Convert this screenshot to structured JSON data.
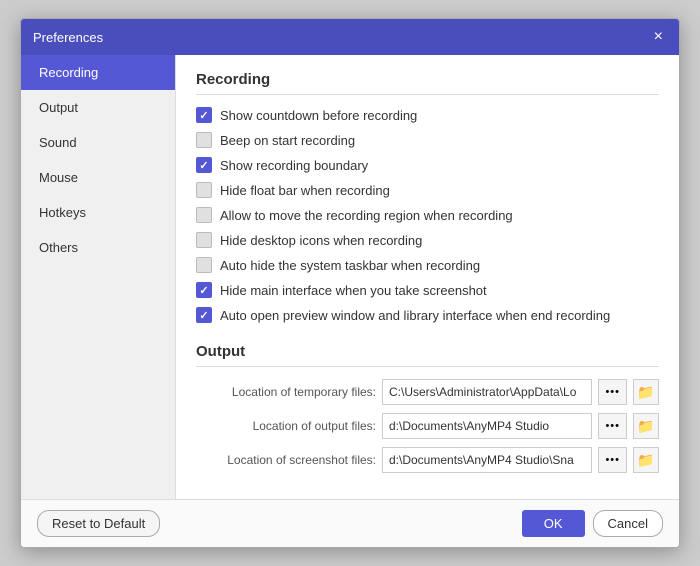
{
  "titleBar": {
    "title": "Preferences",
    "closeLabel": "×"
  },
  "sidebar": {
    "items": [
      {
        "id": "recording",
        "label": "Recording",
        "active": true
      },
      {
        "id": "output",
        "label": "Output",
        "active": false
      },
      {
        "id": "sound",
        "label": "Sound",
        "active": false
      },
      {
        "id": "mouse",
        "label": "Mouse",
        "active": false
      },
      {
        "id": "hotkeys",
        "label": "Hotkeys",
        "active": false
      },
      {
        "id": "others",
        "label": "Others",
        "active": false
      }
    ]
  },
  "recording": {
    "sectionTitle": "Recording",
    "checkboxes": [
      {
        "id": "show-countdown",
        "label": "Show countdown before recording",
        "checked": true
      },
      {
        "id": "beep-start",
        "label": "Beep on start recording",
        "checked": false
      },
      {
        "id": "show-boundary",
        "label": "Show recording boundary",
        "checked": true
      },
      {
        "id": "hide-float-bar",
        "label": "Hide float bar when recording",
        "checked": false
      },
      {
        "id": "allow-move",
        "label": "Allow to move the recording region when recording",
        "checked": false
      },
      {
        "id": "hide-desktop-icons",
        "label": "Hide desktop icons when recording",
        "checked": false
      },
      {
        "id": "auto-hide-taskbar",
        "label": "Auto hide the system taskbar when recording",
        "checked": false
      },
      {
        "id": "hide-main-interface",
        "label": "Hide main interface when you take screenshot",
        "checked": true
      },
      {
        "id": "auto-open-preview",
        "label": "Auto open preview window and library interface when end recording",
        "checked": true
      }
    ]
  },
  "output": {
    "sectionTitle": "Output",
    "fields": [
      {
        "id": "temp-files",
        "label": "Location of temporary files:",
        "value": "C:\\Users\\Administrator\\AppData\\Lo"
      },
      {
        "id": "output-files",
        "label": "Location of output files:",
        "value": "d:\\Documents\\AnyMP4 Studio"
      },
      {
        "id": "screenshot-files",
        "label": "Location of screenshot files:",
        "value": "d:\\Documents\\AnyMP4 Studio\\Sna"
      }
    ],
    "dotsLabel": "•••",
    "folderIcon": "📁"
  },
  "footer": {
    "resetLabel": "Reset to Default",
    "okLabel": "OK",
    "cancelLabel": "Cancel"
  }
}
